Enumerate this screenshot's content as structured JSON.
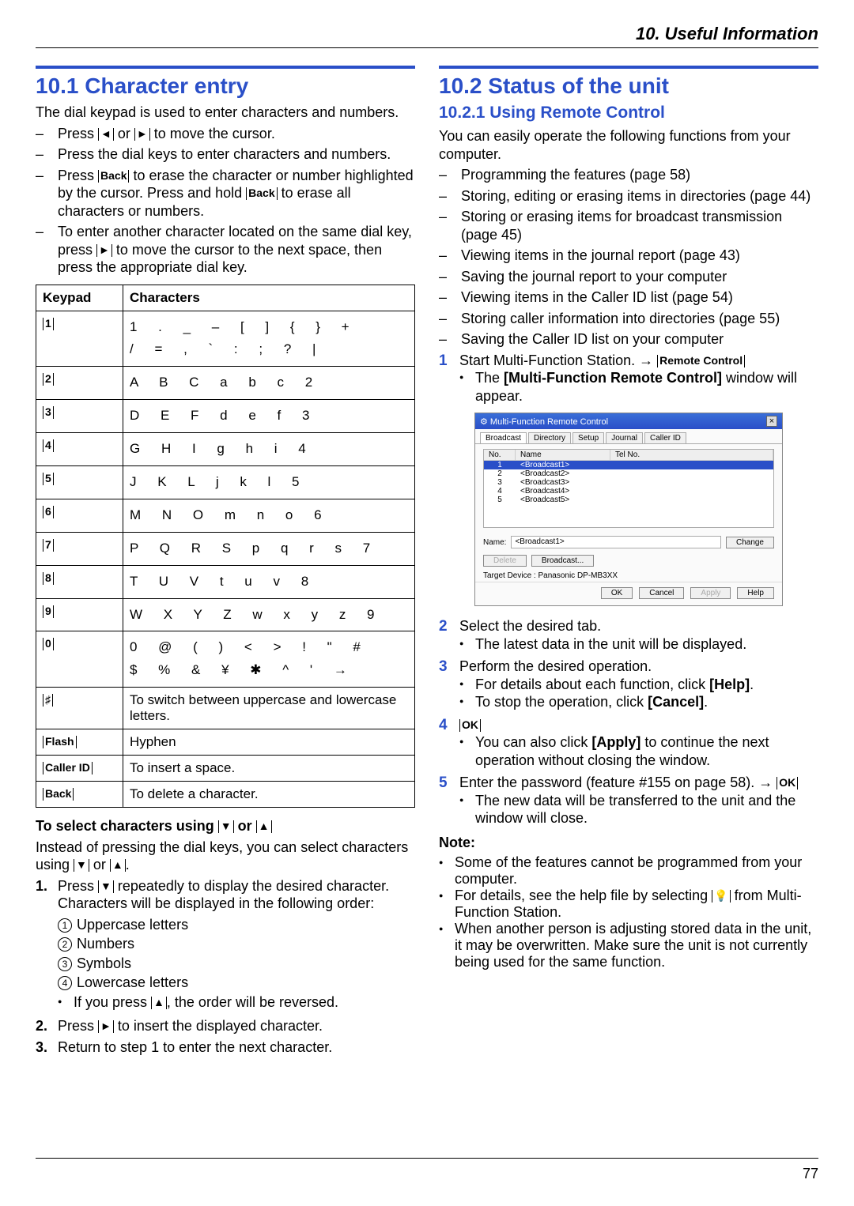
{
  "chapter": "10. Useful Information",
  "page_number": "77",
  "col1": {
    "section_title": "10.1 Character entry",
    "intro": "The dial keypad is used to enter characters and numbers.",
    "k_left": "◄",
    "k_right": "►",
    "k_back": "Back",
    "k_down": "▼",
    "k_up": "▲",
    "bul1_a": "Press ",
    "bul1_b": " or ",
    "bul1_c": " to move the cursor.",
    "bul2": "Press the dial keys to enter characters and numbers.",
    "bul3_a": "Press ",
    "bul3_b": " to erase the character or number highlighted by the cursor. Press and hold ",
    "bul3_c": " to erase all characters or numbers.",
    "bul4_a": "To enter another character located on the same dial key, press ",
    "bul4_b": " to move the cursor to the next space, then press the appropriate dial key.",
    "table": {
      "h_keypad": "Keypad",
      "h_chars": "Characters",
      "rows": [
        {
          "k": "1",
          "c": "1 . _ – [ ] { } +\n/ = , ` : ; ? |"
        },
        {
          "k": "2",
          "c": "A B C a b c 2"
        },
        {
          "k": "3",
          "c": "D E F d e f 3"
        },
        {
          "k": "4",
          "c": "G H I g h i 4"
        },
        {
          "k": "5",
          "c": "J K L j k l 5"
        },
        {
          "k": "6",
          "c": "M N O m n o 6"
        },
        {
          "k": "7",
          "c": "P Q R S p q r s 7"
        },
        {
          "k": "8",
          "c": "T U V t u v 8"
        },
        {
          "k": "9",
          "c": "W X Y Z w x y z 9"
        },
        {
          "k": "0",
          "c": "0 @ ( ) < > ! \" #\n$ % & ¥ ✱ ^ ' →"
        }
      ],
      "hash_k": "♯",
      "hash_c": "To switch between uppercase and lowercase letters.",
      "flash_k": "Flash",
      "flash_c": "Hyphen",
      "cid_k": "Caller ID",
      "cid_c": "To insert a space.",
      "back_k": "Back",
      "back_c": "To delete a character."
    },
    "select_title_a": "To select characters using ",
    "select_title_b": " or ",
    "select_intro_a": "Instead of pressing the dial keys, you can select characters using ",
    "select_intro_b": " or ",
    "select_intro_c": ".",
    "step1_a": "Press ",
    "step1_b": " repeatedly to display the desired character. Characters will be displayed in the following order:",
    "order1": "Uppercase letters",
    "order2": "Numbers",
    "order3": "Symbols",
    "order4": "Lowercase letters",
    "step1_note_a": "If you press ",
    "step1_note_b": ", the order will be reversed.",
    "step2_a": "Press ",
    "step2_b": " to insert the displayed character.",
    "step3": "Return to step 1 to enter the next character."
  },
  "col2": {
    "section_title": "10.2 Status of the unit",
    "subsection_title": "10.2.1 Using Remote Control",
    "intro": "You can easily operate the following functions from your computer.",
    "feat": [
      "Programming the features (page 58)",
      "Storing, editing or erasing items in directories (page 44)",
      "Storing or erasing items for broadcast transmission (page 45)",
      "Viewing items in the journal report (page 43)",
      "Saving the journal report to your computer",
      "Viewing items in the Caller ID list (page 54)",
      "Storing caller information into directories (page 55)",
      "Saving the Caller ID list on your computer"
    ],
    "s1_a": "Start Multi-Function Station. → ",
    "s1_b": "Remote Control",
    "s1_sub_a": "The ",
    "s1_sub_b": "[Multi-Function Remote Control]",
    "s1_sub_c": " window will appear.",
    "shot": {
      "title": "Multi-Function Remote Control",
      "tabs": [
        "Broadcast",
        "Directory",
        "Setup",
        "Journal",
        "Caller ID"
      ],
      "h_no": "No.",
      "h_name": "Name",
      "h_tel": "Tel No.",
      "rows": [
        {
          "no": "1",
          "name": "<Broadcast1>"
        },
        {
          "no": "2",
          "name": "<Broadcast2>"
        },
        {
          "no": "3",
          "name": "<Broadcast3>"
        },
        {
          "no": "4",
          "name": "<Broadcast4>"
        },
        {
          "no": "5",
          "name": "<Broadcast5>"
        }
      ],
      "name_label": "Name:",
      "name_value": "<Broadcast1>",
      "change": "Change",
      "delete": "Delete",
      "broadcast": "Broadcast...",
      "target": "Target Device : Panasonic DP-MB3XX",
      "ok": "OK",
      "cancel": "Cancel",
      "apply": "Apply",
      "help": "Help"
    },
    "s2": "Select the desired tab.",
    "s2_sub": "The latest data in the unit will be displayed.",
    "s3": "Perform the desired operation.",
    "s3_sub1_a": "For details about each function, click ",
    "s3_sub1_b": "[Help]",
    "s3_sub1_c": ".",
    "s3_sub2_a": "To stop the operation, click ",
    "s3_sub2_b": "[Cancel]",
    "s3_sub2_c": ".",
    "s4": "OK",
    "s4_sub_a": "You can also click ",
    "s4_sub_b": "[Apply]",
    "s4_sub_c": " to continue the next operation without closing the window.",
    "s5_a": "Enter the password (feature #155 on page 58). → ",
    "s5_b": "OK",
    "s5_sub": "The new data will be transferred to the unit and the window will close.",
    "note_title": "Note:",
    "note1": "Some of the features cannot be programmed from your computer.",
    "note2_a": "For details, see the help file by selecting ",
    "note2_icon": "💡",
    "note2_b": " from Multi-Function Station.",
    "note3": "When another person is adjusting stored data in the unit, it may be overwritten. Make sure the unit is not currently being used for the same function."
  }
}
